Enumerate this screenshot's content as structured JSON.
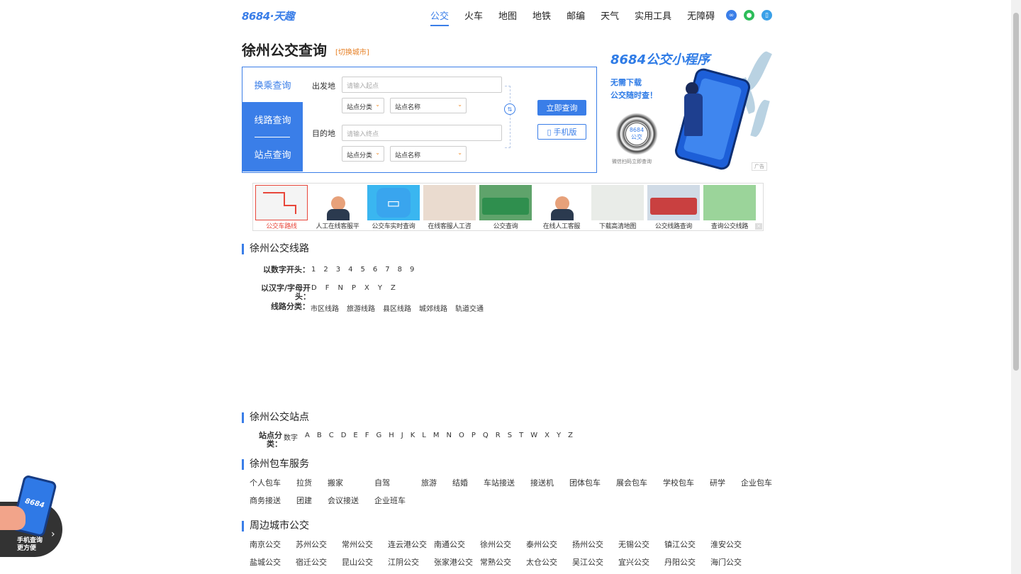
{
  "header": {
    "logo": "8684·天趣",
    "nav": [
      "公交",
      "火车",
      "地图",
      "地铁",
      "邮编",
      "天气",
      "实用工具",
      "无障碍"
    ],
    "active_index": 0
  },
  "page": {
    "title": "徐州公交查询",
    "switch_city": "[切换城市]"
  },
  "query": {
    "tabs": [
      "换乘查询",
      "线路查询",
      "站点查询"
    ],
    "from_label": "出发地",
    "to_label": "目的地",
    "from_placeholder": "请输入起点",
    "to_placeholder": "请输入终点",
    "category_select": "站点分类",
    "name_select": "站点名称",
    "submit": "立即查询",
    "mobile": "手机版"
  },
  "mini_ad": {
    "title": "8684公交小程序",
    "line1": "无需下载",
    "line2": "公交随时查！",
    "qr_text": "8684 公交",
    "caption": "微信扫码立即查询",
    "ad_tag": "广告"
  },
  "ad_strip": [
    "公交车路线",
    "人工在线客服平",
    "公交车实时查询",
    "在线客服人工咨",
    "公交查询",
    "在线人工客服",
    "下载高清地图",
    "公交线路查询",
    "查询公交线路"
  ],
  "lines_section": {
    "title": "徐州公交线路",
    "number_label": "以数字开头：",
    "numbers": [
      "1",
      "2",
      "3",
      "4",
      "5",
      "6",
      "7",
      "8",
      "9"
    ],
    "letter_label": "以汉字/字母开头：",
    "letters": [
      "D",
      "F",
      "N",
      "P",
      "X",
      "Y",
      "Z"
    ],
    "category_label": "线路分类：",
    "categories": [
      "市区线路",
      "旅游线路",
      "县区线路",
      "城郊线路",
      "轨道交通"
    ]
  },
  "stops_section": {
    "title": "徐州公交站点",
    "label": "站点分类：",
    "items": [
      "数字",
      "A",
      "B",
      "C",
      "D",
      "E",
      "F",
      "G",
      "H",
      "J",
      "K",
      "L",
      "M",
      "N",
      "O",
      "P",
      "Q",
      "R",
      "S",
      "T",
      "W",
      "X",
      "Y",
      "Z"
    ]
  },
  "charter_section": {
    "title": "徐州包车服务",
    "items": [
      "个人包车",
      "拉货",
      "搬家",
      "自驾",
      "旅游",
      "结婚",
      "车站接送",
      "接送机",
      "团体包车",
      "展会包车",
      "学校包车",
      "研学",
      "企业包车",
      "商务接送",
      "团建",
      "会议接送",
      "企业班车"
    ]
  },
  "nearby_section": {
    "title": "周边城市公交",
    "items": [
      "南京公交",
      "苏州公交",
      "常州公交",
      "连云港公交",
      "南通公交",
      "徐州公交",
      "泰州公交",
      "扬州公交",
      "无锡公交",
      "镇江公交",
      "淮安公交",
      "盐城公交",
      "宿迁公交",
      "昆山公交",
      "江阴公交",
      "张家港公交",
      "常熟公交",
      "太仓公交",
      "吴江公交",
      "宜兴公交",
      "丹阳公交",
      "海门公交"
    ]
  },
  "float": {
    "line1": "手机查询",
    "line2": "更方便",
    "phone_text": "8684"
  },
  "colors": {
    "accent": "#3a7ee8",
    "orange": "#e67e22",
    "ad_red": "#e8463a"
  }
}
